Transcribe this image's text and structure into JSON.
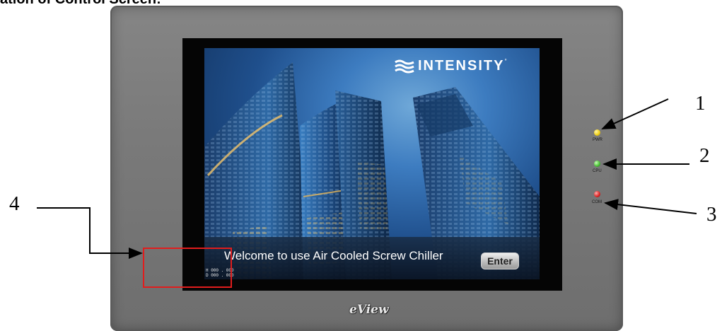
{
  "section_title": "ation of Control Screen:",
  "screen": {
    "logo_text": "INTENSITY",
    "logo_trademark": "°",
    "welcome_text": "Welcome to use Air Cooled Screw Chiller",
    "enter_label": "Enter",
    "readout_h": "H 000 . 000",
    "readout_d": "D 000 . 000"
  },
  "leds": [
    {
      "label": "PWR",
      "color": "#f2d21a"
    },
    {
      "label": "CPU",
      "color": "#4fc43a"
    },
    {
      "label": "COM",
      "color": "#e12a2a"
    }
  ],
  "brand": "eView",
  "callouts": [
    "1",
    "2",
    "3",
    "4"
  ],
  "highlight_color": "#e11d1d"
}
